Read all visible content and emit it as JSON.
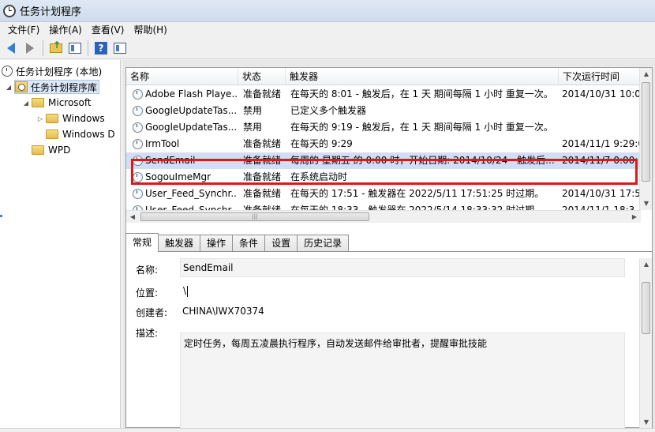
{
  "window": {
    "title": "任务计划程序"
  },
  "menu": [
    {
      "label": "文件(F)"
    },
    {
      "label": "操作(A)"
    },
    {
      "label": "查看(V)"
    },
    {
      "label": "帮助(H)"
    }
  ],
  "toolbar": {
    "icons": [
      "back-arrow-icon",
      "forward-arrow-icon",
      "folder-up-icon",
      "show-hide-console-tree-icon",
      "help-icon",
      "action-pane-icon"
    ],
    "help_glyph": "?"
  },
  "tree": {
    "root": "任务计划程序 (本地)",
    "library": "任务计划程序库",
    "microsoft": "Microsoft",
    "windows1": "Windows",
    "windows2": "Windows D",
    "wpd": "WPD"
  },
  "task_list": {
    "columns": {
      "name": "名称",
      "status": "状态",
      "trigger": "触发器",
      "next_run": "下次运行时间"
    },
    "rows": [
      {
        "name": "Adobe Flash Playe...",
        "status": "准备就绪",
        "trigger": "在每天的 8:01 - 触发后，在 1 天 期间每隔 1 小时 重复一次。",
        "next_run": "2014/10/31 10:0"
      },
      {
        "name": "GoogleUpdateTas...",
        "status": "禁用",
        "trigger": "已定义多个触发器",
        "next_run": ""
      },
      {
        "name": "GoogleUpdateTas...",
        "status": "禁用",
        "trigger": "在每天的 9:19 - 触发后，在 1 天 期间每隔 1 小时 重复一次。",
        "next_run": ""
      },
      {
        "name": "IrmTool",
        "status": "准备就绪",
        "trigger": "在每天的 9:29",
        "next_run": "2014/11/1 9:29:0"
      },
      {
        "name": "SendEmail",
        "status": "准备就绪",
        "trigger": "每周的 星期五 的 0:00 时，开始日期: 2014/10/24 - 触发后...",
        "next_run": "2014/11/7 0:00:"
      },
      {
        "name": "SogouImeMgr",
        "status": "准备就绪",
        "trigger": "在系统启动时",
        "next_run": ""
      },
      {
        "name": "User_Feed_Synchr...",
        "status": "准备就绪",
        "trigger": "在每天的 17:51 - 触发器在 2022/5/11 17:51:25 时过期。",
        "next_run": "2014/10/31 17:5"
      },
      {
        "name": "User_Feed_Synchr...",
        "status": "准备就绪",
        "trigger": "在每天的 18:33 - 触发器在 2022/5/14 18:33:32 时过期。",
        "next_run": "2014/11/1 18:3"
      }
    ],
    "selected_index": 4
  },
  "tabs": [
    {
      "label": "常规"
    },
    {
      "label": "触发器"
    },
    {
      "label": "操作"
    },
    {
      "label": "条件"
    },
    {
      "label": "设置"
    },
    {
      "label": "历史记录"
    }
  ],
  "general": {
    "name_label": "名称:",
    "name_value": "SendEmail",
    "location_label": "位置:",
    "location_value": "\\",
    "author_label": "创建者:",
    "author_value": "CHINA\\lWX70374",
    "desc_label": "描述:",
    "desc_value": "定时任务，每周五凌晨执行程序，自动发送邮件给审批者，提醒审批技能"
  }
}
